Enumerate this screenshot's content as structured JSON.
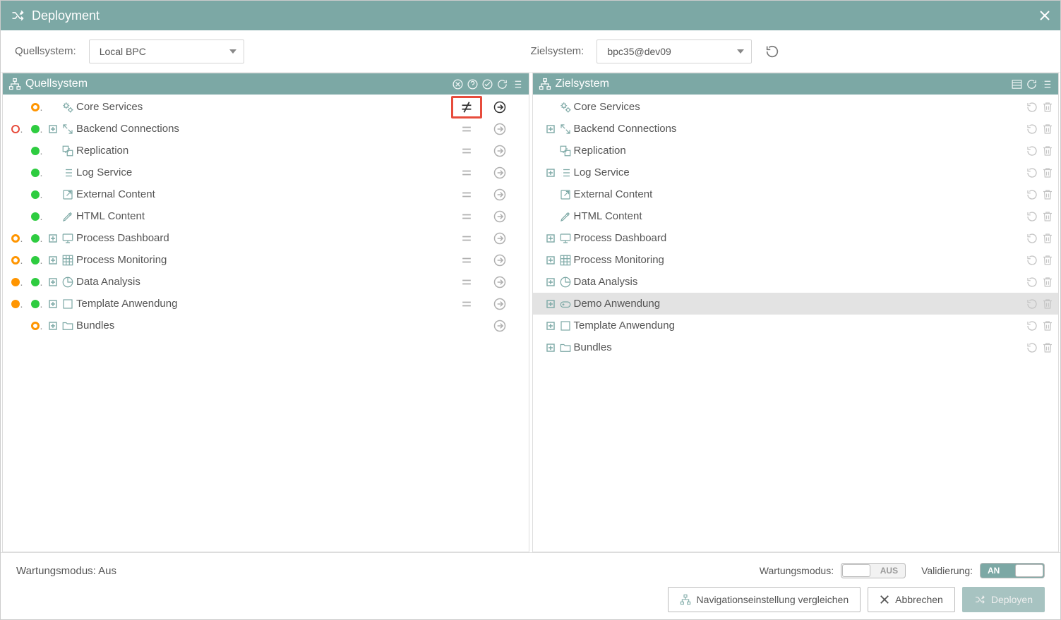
{
  "title": "Deployment",
  "source": {
    "label": "Quellsystem:",
    "selected": "Local BPC",
    "panel_title": "Quellsystem"
  },
  "target": {
    "label": "Zielsystem:",
    "selected": "bpc35@dev09",
    "panel_title": "Zielsystem"
  },
  "source_items": [
    {
      "status1": "",
      "status2": "orange-hole",
      "expand": false,
      "icon": "gears",
      "label": "Core Services",
      "diff": "neq",
      "diff_highlight": true,
      "action": "arrow-dark"
    },
    {
      "status1": "red-ring",
      "status2": "green",
      "expand": true,
      "icon": "expand-arrows",
      "label": "Backend Connections",
      "diff": "eq",
      "action": "arrow"
    },
    {
      "status1": "",
      "status2": "green",
      "expand": false,
      "icon": "replication",
      "label": "Replication",
      "diff": "eq",
      "action": "arrow"
    },
    {
      "status1": "",
      "status2": "green",
      "expand": false,
      "icon": "list",
      "label": "Log Service",
      "diff": "eq",
      "action": "arrow"
    },
    {
      "status1": "",
      "status2": "green",
      "expand": false,
      "icon": "external",
      "label": "External Content",
      "diff": "eq",
      "action": "arrow"
    },
    {
      "status1": "",
      "status2": "green",
      "expand": false,
      "icon": "pen",
      "label": "HTML Content",
      "diff": "eq",
      "action": "arrow"
    },
    {
      "status1": "orange-ring",
      "status2": "green",
      "expand": true,
      "icon": "monitor",
      "label": "Process Dashboard",
      "diff": "eq",
      "action": "arrow"
    },
    {
      "status1": "orange-ring",
      "status2": "green",
      "expand": true,
      "icon": "grid",
      "label": "Process Monitoring",
      "diff": "eq",
      "action": "arrow"
    },
    {
      "status1": "orange",
      "status2": "green",
      "expand": true,
      "icon": "pie",
      "label": "Data Analysis",
      "diff": "eq",
      "action": "arrow"
    },
    {
      "status1": "orange",
      "status2": "green",
      "expand": true,
      "icon": "square",
      "label": "Template Anwendung",
      "diff": "eq",
      "action": "arrow"
    },
    {
      "status1": "",
      "status2": "orange-hole",
      "expand": true,
      "icon": "folder",
      "label": "Bundles",
      "diff": "",
      "action": "arrow"
    }
  ],
  "target_items": [
    {
      "expand": false,
      "icon": "gears",
      "label": "Core Services"
    },
    {
      "expand": true,
      "icon": "expand-arrows",
      "label": "Backend Connections"
    },
    {
      "expand": false,
      "icon": "replication",
      "label": "Replication"
    },
    {
      "expand": true,
      "icon": "list",
      "label": "Log Service"
    },
    {
      "expand": false,
      "icon": "external",
      "label": "External Content"
    },
    {
      "expand": false,
      "icon": "pen",
      "label": "HTML Content"
    },
    {
      "expand": true,
      "icon": "monitor",
      "label": "Process Dashboard"
    },
    {
      "expand": true,
      "icon": "grid",
      "label": "Process Monitoring"
    },
    {
      "expand": true,
      "icon": "pie",
      "label": "Data Analysis"
    },
    {
      "expand": true,
      "icon": "gamepad",
      "label": "Demo Anwendung",
      "highlight": true
    },
    {
      "expand": true,
      "icon": "square",
      "label": "Template Anwendung"
    },
    {
      "expand": true,
      "icon": "folder",
      "label": "Bundles"
    }
  ],
  "footer": {
    "maint_src": "Wartungsmodus: Aus",
    "maint_tgt_label": "Wartungsmodus:",
    "maint_tgt_val": "AUS",
    "validation_label": "Validierung:",
    "validation_val": "AN",
    "btn_compare": "Navigationseinstellung vergleichen",
    "btn_cancel": "Abbrechen",
    "btn_deploy": "Deployen"
  }
}
